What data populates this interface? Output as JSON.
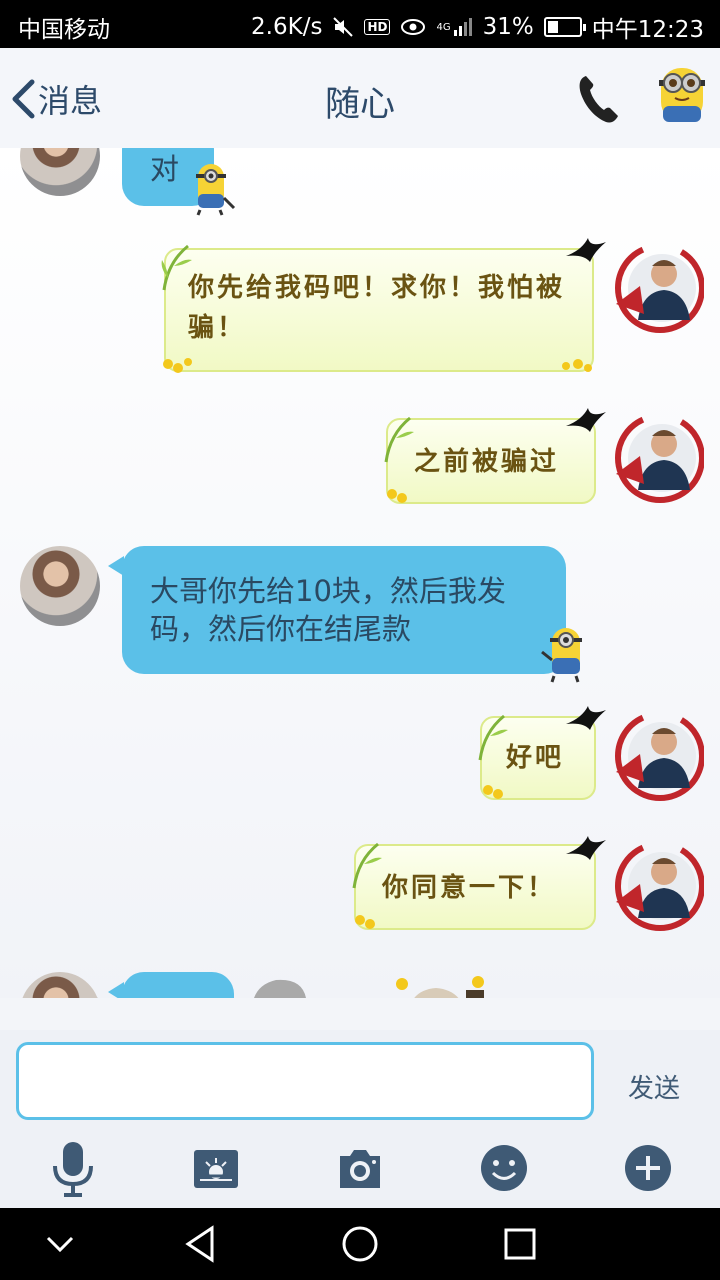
{
  "status_bar": {
    "carrier": "中国移动",
    "speed": "2.6K/s",
    "hd": "HD",
    "network": "4G",
    "battery": "31%",
    "time": "中午12:23"
  },
  "header": {
    "back_label": "消息",
    "title": "随心"
  },
  "messages": [
    {
      "side": "left",
      "text": "对"
    },
    {
      "side": "right",
      "text": "你先给我码吧！求你！我怕被骗！"
    },
    {
      "side": "right",
      "text": "之前被骗过"
    },
    {
      "side": "left",
      "text": "大哥你先给10块，然后我发码，然后你在结尾款"
    },
    {
      "side": "right",
      "text": "好吧"
    },
    {
      "side": "right",
      "text": "你同意一下！"
    }
  ],
  "input": {
    "value": "",
    "send_label": "发送"
  },
  "toolbar": [
    "mic-icon",
    "image-icon",
    "camera-icon",
    "emoji-icon",
    "plus-icon"
  ],
  "colors": {
    "accent": "#5bc0e8",
    "header_text": "#2d4a6a",
    "toolbar_icon": "#3f5a75"
  }
}
